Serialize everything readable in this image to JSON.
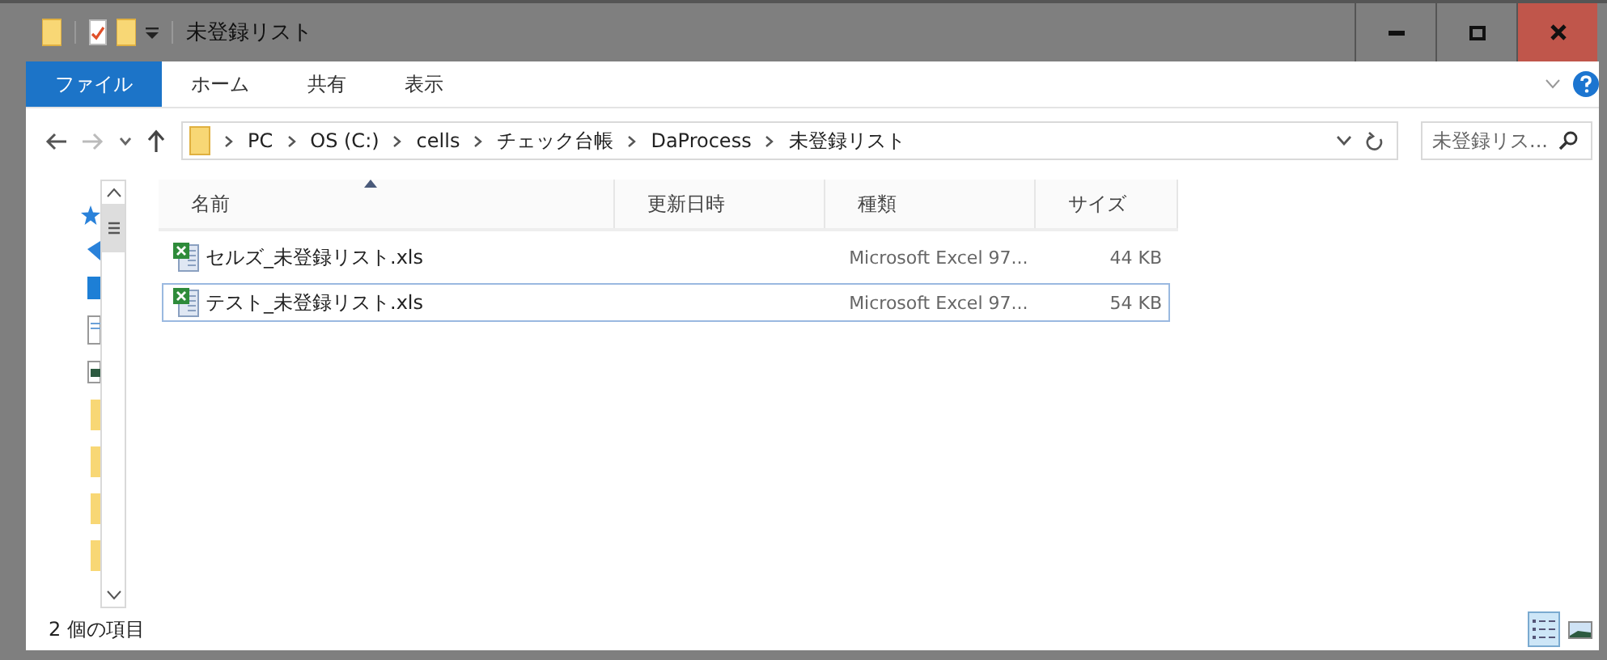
{
  "window": {
    "title": "未登録リスト"
  },
  "ribbon_tabs": [
    {
      "label": "ファイル",
      "selected": true
    },
    {
      "label": "ホーム",
      "selected": false
    },
    {
      "label": "共有",
      "selected": false
    },
    {
      "label": "表示",
      "selected": false
    }
  ],
  "address_bar": {
    "path": [
      "PC",
      "OS (C:)",
      "cells",
      "チェック台帳",
      "DaProcess",
      "未登録リスト"
    ]
  },
  "search": {
    "placeholder": "未登録リス..."
  },
  "table": {
    "columns": [
      {
        "label": "名前",
        "sorted": true
      },
      {
        "label": "更新日時",
        "sorted": false
      },
      {
        "label": "種類",
        "sorted": false
      },
      {
        "label": "サイズ",
        "sorted": false
      }
    ],
    "rows": [
      {
        "name": "セルズ_未登録リスト.xls",
        "type": "Microsoft Excel 97...",
        "size": "44 KB",
        "focused": false
      },
      {
        "name": "テスト_未登録リスト.xls",
        "type": "Microsoft Excel 97...",
        "size": "54 KB",
        "focused": true
      }
    ]
  },
  "status_bar": {
    "item_count": "2 個の項目"
  },
  "view_buttons": [
    {
      "kind": "details",
      "selected": true
    },
    {
      "kind": "thumbnails",
      "selected": false
    }
  ]
}
